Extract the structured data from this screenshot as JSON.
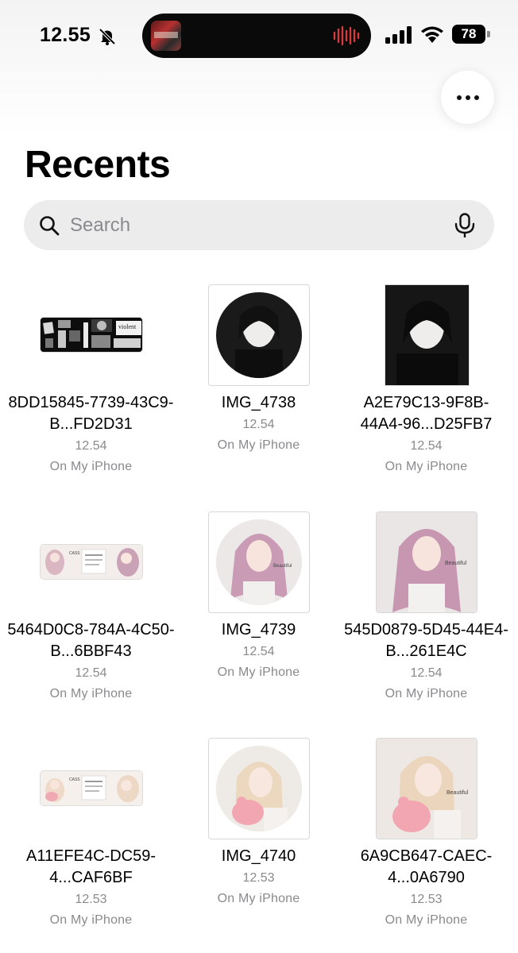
{
  "status_bar": {
    "time": "12.55",
    "battery": "78"
  },
  "header": {
    "title": "Recents",
    "more_icon": "ellipsis-icon"
  },
  "search": {
    "placeholder": "Search",
    "icon": "search-icon",
    "mic_icon": "microphone-icon"
  },
  "files": [
    {
      "name": "8DD15845-7739-43C9-B...FD2D31",
      "time": "12.54",
      "location": "On My iPhone"
    },
    {
      "name": "IMG_4738",
      "time": "12.54",
      "location": "On My iPhone"
    },
    {
      "name": "A2E79C13-9F8B-44A4-96...D25FB7",
      "time": "12.54",
      "location": "On My iPhone"
    },
    {
      "name": "5464D0C8-784A-4C50-B...6BBF43",
      "time": "12.54",
      "location": "On My iPhone"
    },
    {
      "name": "IMG_4739",
      "time": "12.54",
      "location": "On My iPhone"
    },
    {
      "name": "545D0879-5D45-44E4-B...261E4C",
      "time": "12.54",
      "location": "On My iPhone"
    },
    {
      "name": "A11EFE4C-DC59-4...CAF6BF",
      "time": "12.53",
      "location": "On My iPhone"
    },
    {
      "name": "IMG_4740",
      "time": "12.53",
      "location": "On My iPhone"
    },
    {
      "name": "6A9CB647-CAEC-4...0A6790",
      "time": "12.53",
      "location": "On My iPhone"
    }
  ]
}
